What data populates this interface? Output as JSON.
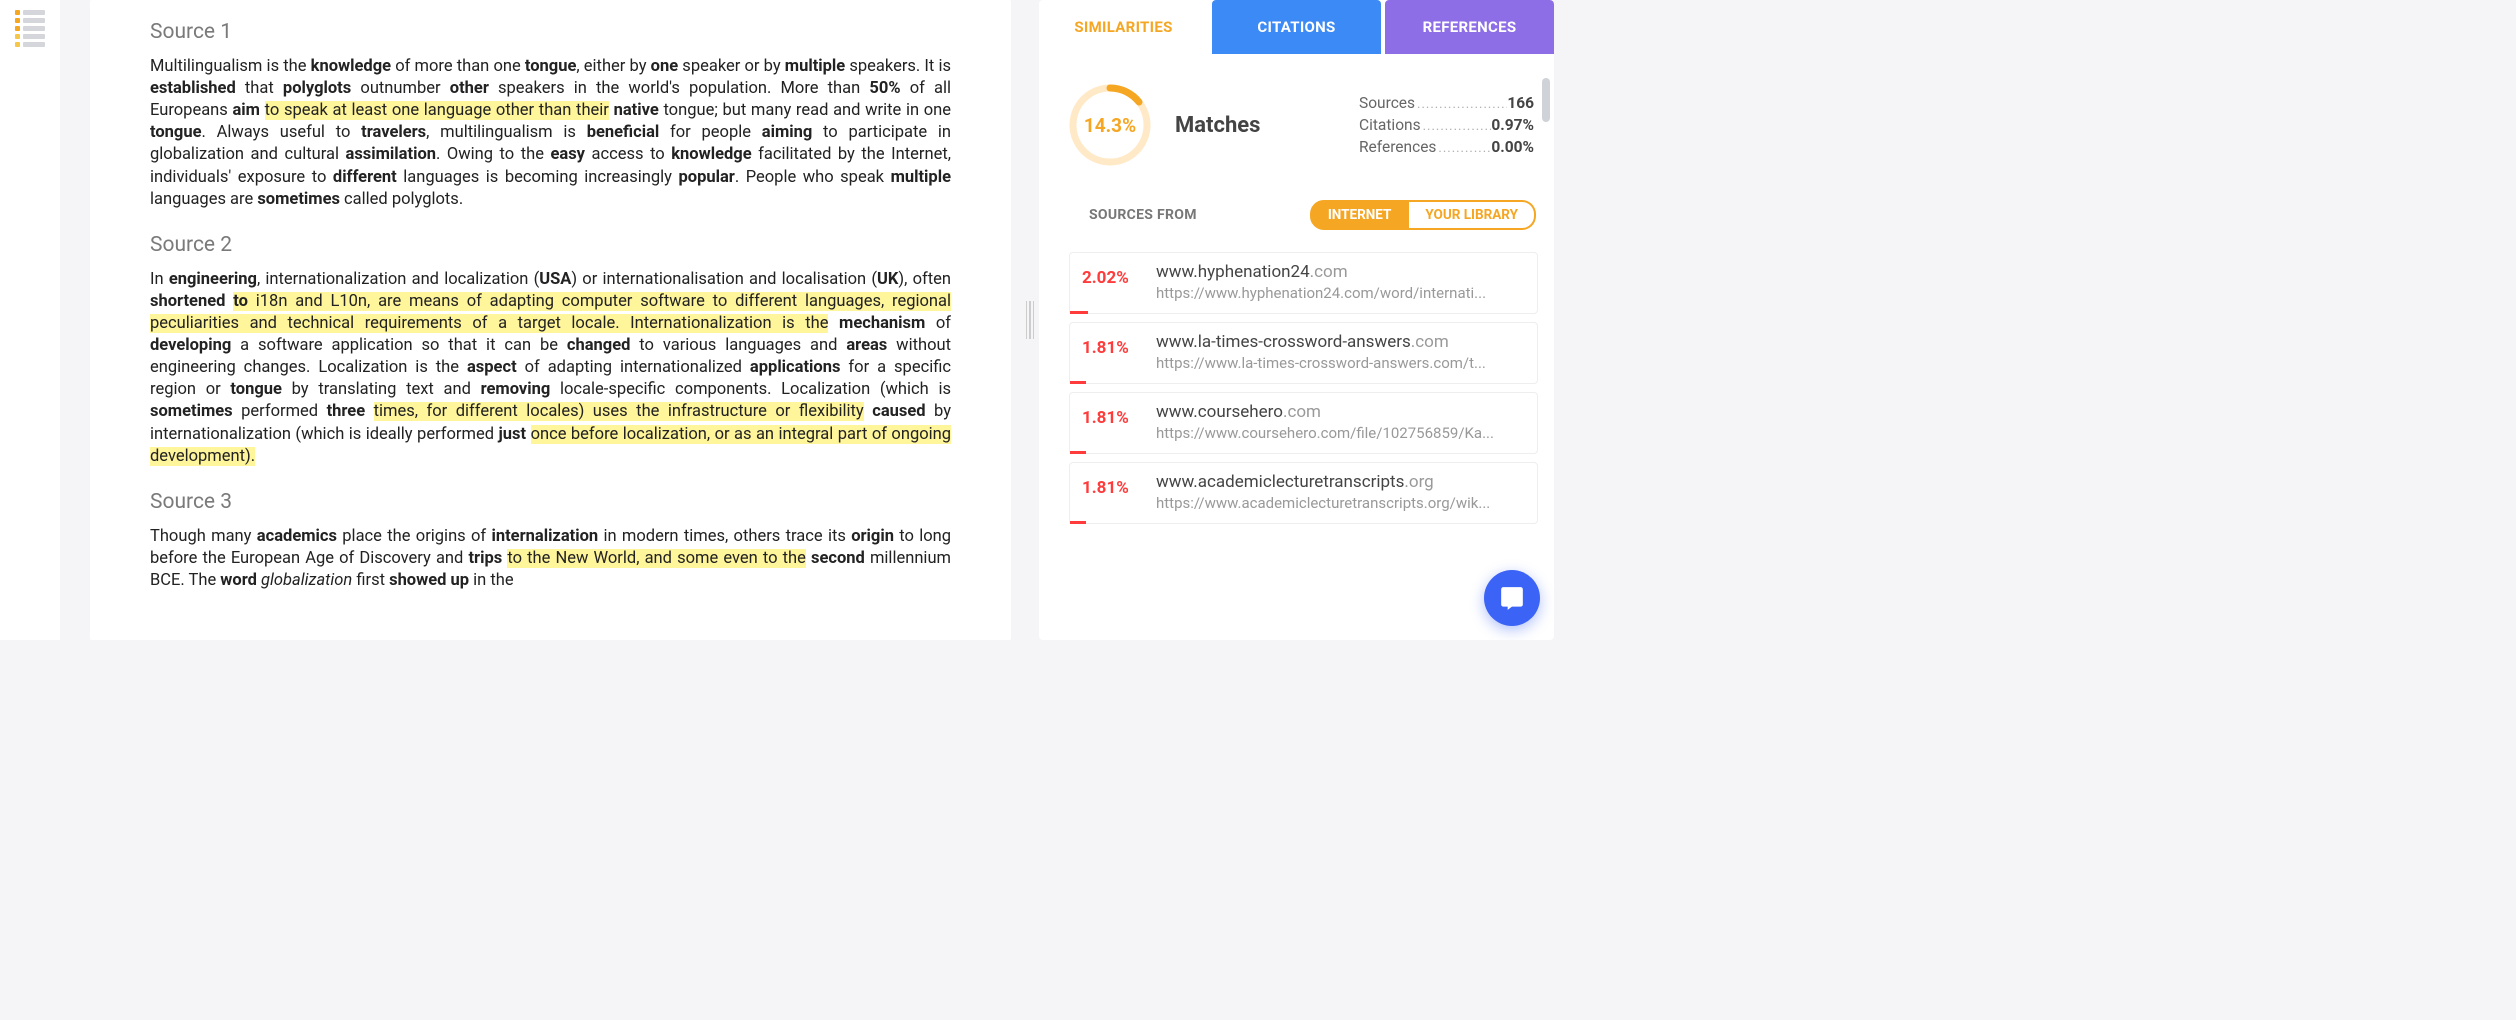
{
  "rail": {
    "icon_name": "outline-icon",
    "row_colors": [
      "#f5a623",
      "#f5a623",
      "#f5a623",
      "#f5c84a",
      "#f5c84a"
    ]
  },
  "doc": {
    "sources": [
      {
        "title": "Source 1",
        "body": "Multilingualism is the <b>knowledge</b> of more than one <b>tongue</b>, either by <b>one</b> speaker or by <b>multiple</b> speakers. It is <b>established</b> that <b>polyglots</b> outnumber <b>other</b> speakers in the world's population. More than <b>50%</b> of all Europeans <b>aim</b> <span class=\"hl\">to speak at least one language other than their</span> <b>native</b> tongue; but many read and write in one <b>tongue</b>. Always useful to <b>travelers</b>, multilingualism is <b>beneficial</b> for people <b>aiming</b> to participate in globalization and cultural <b>assimilation</b>. Owing to the <b>easy</b> access to <b>knowledge</b> facilitated by the Internet, individuals' exposure to <b>different</b> languages is becoming increasingly <b>popular</b>. People who speak <b>multiple</b> languages are <b>sometimes</b> called polyglots."
      },
      {
        "title": "Source 2",
        "body": "In <b>engineering</b>, internationalization and localization (<b>USA</b>) or internationalisation and localisation (<b>UK</b>), often <b>shortened</b> <span class=\"hl\"><b>to</b> i18n and L10n, are means of adapting computer software to different languages, regional peculiarities and technical requirements of a target locale. Internationalization is the</span> <b>mechanism</b> of <b>developing</b> a software application so that it can be <b>changed</b> to various languages and <b>areas</b> without engineering changes. Localization is the <b>aspect</b> of adapting internationalized <b>applications</b> for a specific region or <b>tongue</b> by translating text and <b>removing</b> locale-specific components. Localization (which is <b>sometimes</b> performed <b>three</b> <span class=\"hl\">times, for different locales) uses the infrastructure or flexibility</span> <b>caused</b> by internationalization (which is ideally performed <b>just</b> <span class=\"hl\">once before localization, or as an integral part of ongoing development).</span>"
      },
      {
        "title": "Source 3",
        "body": "Though many <b>academics</b> place the origins of <b>internalization</b> in modern times, others trace its <b>origin</b> to long before the European Age of Discovery and <b>trips</b> <span class=\"hl\">to the New World, and some even to the</span> <b>second</b> millennium BCE. The <b>word</b> <i>globalization</i> first <b>showed up</b> in the"
      }
    ]
  },
  "panel": {
    "tabs": {
      "similarities": "SIMILARITIES",
      "citations": "CITATIONS",
      "references": "REFERENCES"
    },
    "match_pct": "14.3%",
    "matches_label": "Matches",
    "ring_fraction": 0.143,
    "stats": {
      "sources": {
        "label": "Sources",
        "value": "166"
      },
      "citations": {
        "label": "Citations",
        "value": "0.97%"
      },
      "references": {
        "label": "References",
        "value": "0.00%"
      }
    },
    "sources_from_label": "SOURCES FROM",
    "pills": {
      "internet": "INTERNET",
      "library": "YOUR LIBRARY"
    },
    "items": [
      {
        "pct": "2.02%",
        "domain": "www.hyphenation24",
        "tld": ".com",
        "url": "https://www.hyphenation24.com/word/internati...",
        "bar": 18
      },
      {
        "pct": "1.81%",
        "domain": "www.la-times-crossword-answers",
        "tld": ".com",
        "url": "https://www.la-times-crossword-answers.com/t...",
        "bar": 16
      },
      {
        "pct": "1.81%",
        "domain": "www.coursehero",
        "tld": ".com",
        "url": "https://www.coursehero.com/file/102756859/Ka...",
        "bar": 16
      },
      {
        "pct": "1.81%",
        "domain": "www.academiclecturetranscripts",
        "tld": ".org",
        "url": "https://www.academiclecturetranscripts.org/wik...",
        "bar": 16
      }
    ]
  },
  "fab": {
    "name": "chat-icon"
  }
}
